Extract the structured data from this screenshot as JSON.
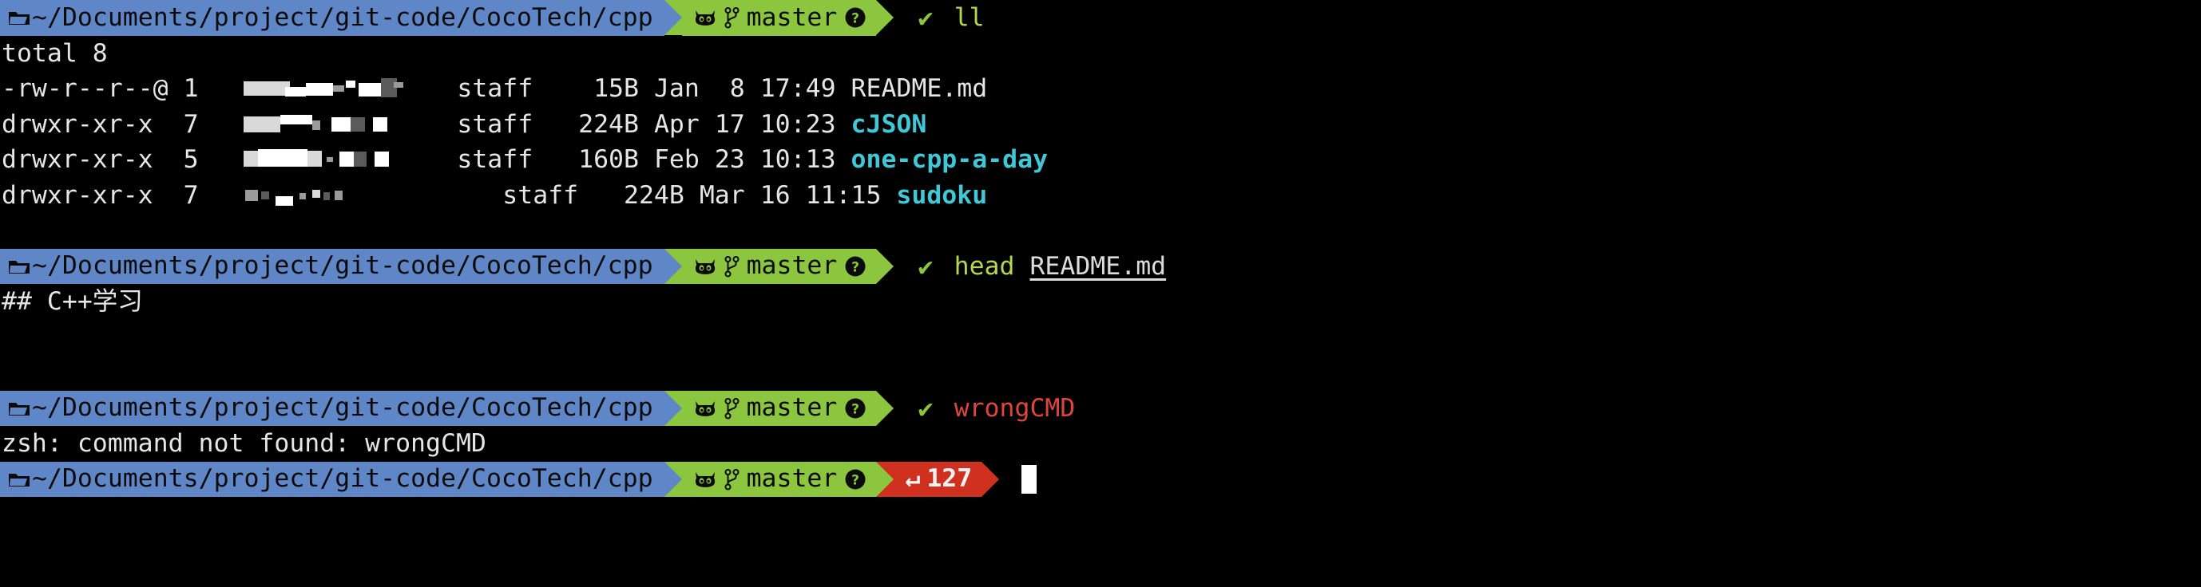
{
  "terminal": {
    "shell": "zsh",
    "colors": {
      "background": "#000000",
      "foreground": "#e6e6e6",
      "path_segment": "#5f87c8",
      "git_segment": "#8cc63e",
      "error_segment": "#d03020",
      "directory_name": "#3fc8d8",
      "command_ok": "#b5d651",
      "command_err": "#e0453c",
      "check_mark": "#8cc63e"
    },
    "prompt": {
      "path": "~/Documents/project/git-code/CocoTech/cpp",
      "branch": "master",
      "folder_icon": "folder-icon",
      "git_host_icon": "github-octocat-icon",
      "branch_icon": "git-branch-icon",
      "status_icon": "question-mark-badge-icon",
      "ok_icon": "check-mark-icon",
      "error_icon": "return-arrow-icon"
    },
    "blocks": [
      {
        "id": "block-ll",
        "status": "ok",
        "command": "ll",
        "command_arg": "",
        "exit_code": null
      },
      {
        "id": "block-head",
        "status": "ok",
        "command": "head",
        "command_arg": "README.md",
        "exit_code": null
      },
      {
        "id": "block-wrongcmd",
        "status": "error",
        "command": "wrongCMD",
        "command_arg": "",
        "exit_code": "127"
      }
    ],
    "ls_output": {
      "total_line": "total 8",
      "columns": [
        "permissions",
        "links",
        "owner",
        "group",
        "size",
        "month",
        "day",
        "time",
        "name"
      ],
      "rows": [
        {
          "permissions": "-rw-r--r--@",
          "links": "1",
          "owner": "[redacted]",
          "group": "staff",
          "size": "15B",
          "month": "Jan",
          "day": "8",
          "time": "17:49",
          "name": "README.md",
          "is_dir": false
        },
        {
          "permissions": "drwxr-xr-x",
          "links": "7",
          "owner": "[redacted]",
          "group": "staff",
          "size": "224B",
          "month": "Apr",
          "day": "17",
          "time": "10:23",
          "name": "cJSON",
          "is_dir": true
        },
        {
          "permissions": "drwxr-xr-x",
          "links": "5",
          "owner": "[redacted]",
          "group": "staff",
          "size": "160B",
          "month": "Feb",
          "day": "23",
          "time": "10:13",
          "name": "one-cpp-a-day",
          "is_dir": true
        },
        {
          "permissions": "drwxr-xr-x",
          "links": "7",
          "owner": "[redacted]",
          "group": "staff",
          "size": "224B",
          "month": "Mar",
          "day": "16",
          "time": "11:15",
          "name": "sudoku",
          "is_dir": true
        }
      ]
    },
    "head_output": "## C++学习",
    "error_output": "zsh: command not found: wrongCMD",
    "exit_code_label": "127",
    "exit_code_symbol": "↵"
  }
}
